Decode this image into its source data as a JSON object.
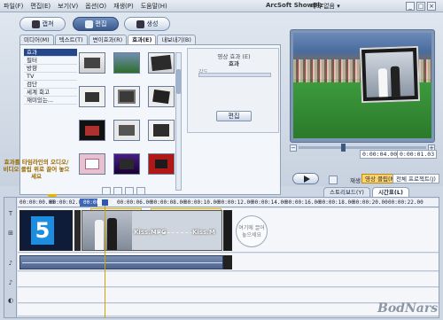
{
  "menu": {
    "items": [
      "파일(F)",
      "편집(E)",
      "보기(V)",
      "옵션(O)",
      "재생(P)",
      "도움말(H)"
    ]
  },
  "app": {
    "title": "ArcSoft ShowBiz",
    "project": "제목 없음 ▾",
    "controls": [
      "_",
      "□",
      "×"
    ]
  },
  "modes": {
    "capture": "캡쳐",
    "edit": "편집",
    "create": "생성"
  },
  "tabs": [
    "미디어(M)",
    "텍스트(T)",
    "변이효과(R)",
    "효과(E)",
    "내보내기(B)"
  ],
  "categories": [
    "효과",
    "필터",
    "방향",
    "TV",
    "검단",
    "세계 회고",
    "재미있는..."
  ],
  "hint": "효과를 타임라인의 오디오/비디오 클립 위로 끌어 놓으세요",
  "settings": {
    "title": "영상 효과 (E)",
    "subtitle": "효과",
    "slider_label": "강도",
    "edit_button": "편집"
  },
  "preview": {
    "time_start": "0:00:04.00",
    "time_end": "0:00:01.03",
    "play_label": "재생",
    "mode_clip": "영상 클립(M)",
    "mode_project": "전체 프로젝트(J)",
    "minus": "−",
    "plus": "+"
  },
  "timeline_tabs": {
    "storyboard": "스토리보드(Y)",
    "timeline": "시간표(L)"
  },
  "ruler_ticks": [
    "00:00:00.00",
    "00:00:02.00",
    "00:00:04.00",
    "00:00:06.00",
    "00:00:08.00",
    "00:00:10.00",
    "00:00:12.00",
    "00:00:14.00",
    "00:00:16.00",
    "00:00:18.00",
    "00:00:20.00",
    "00:00:22.00"
  ],
  "clips": {
    "five_label": "5",
    "kiss_label_left": "Kiss.MPG",
    "kiss_label_right": "Kiss.M",
    "drop_text": "여기에 끌어 놓으세요"
  },
  "strip_icons": [
    "T",
    "⊞",
    "♪",
    "♪",
    "◐"
  ],
  "watermark": "BodNars",
  "colors": {
    "active_blue": "#24468a",
    "playhead": "#c9a600",
    "highlight": "#ffd36b"
  }
}
